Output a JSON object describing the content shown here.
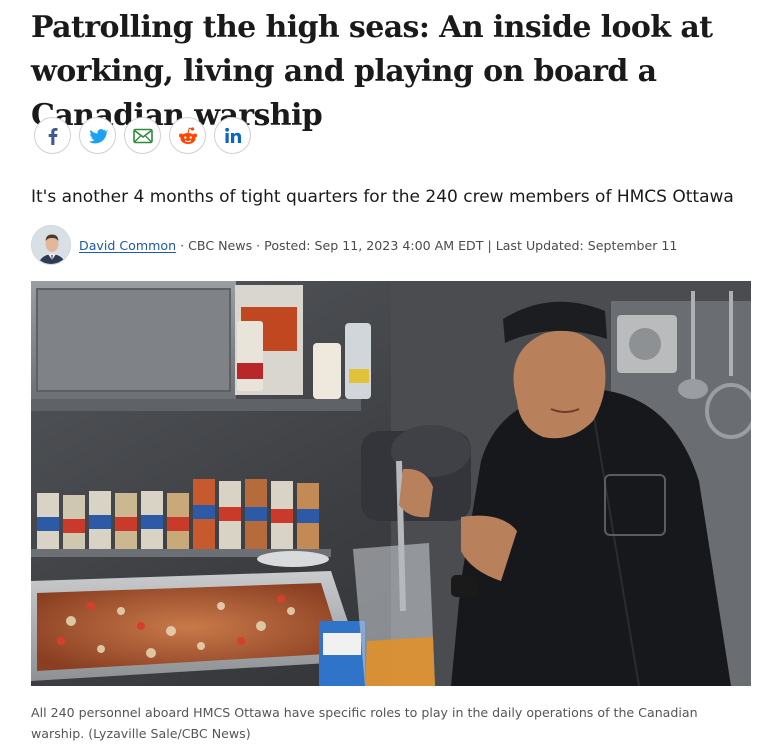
{
  "article": {
    "headline": "Patrolling the high seas: An inside look at working, living and playing on board a Canadian warship",
    "deck": "It's another 4 months of tight quarters for the 240 crew members of HMCS Ottawa",
    "byline": {
      "author": "David Common",
      "separator1": " · ",
      "outlet": "CBC News",
      "separator2": " · ",
      "posted": "Posted: Sep 11, 2023 4:00 AM EDT",
      "separator3": " | ",
      "updated": "Last Updated: September 11"
    },
    "caption": "All 240 personnel aboard HMCS Ottawa have specific roles to play in the daily operations of the Canadian warship. (Lyzaville Sale/CBC News)"
  },
  "share": {
    "buttons": [
      {
        "icon": "facebook-icon",
        "color": "#3b5998"
      },
      {
        "icon": "twitter-icon",
        "color": "#1da1f2"
      },
      {
        "icon": "email-icon",
        "color": "#2f8a3c"
      },
      {
        "icon": "reddit-icon",
        "color": "#ff4500"
      },
      {
        "icon": "linkedin-icon",
        "color": "#0a66c2"
      }
    ]
  },
  "colors": {
    "link": "#1d5aa8",
    "headline": "#1a1a1a",
    "meta": "#4a4a4a"
  }
}
